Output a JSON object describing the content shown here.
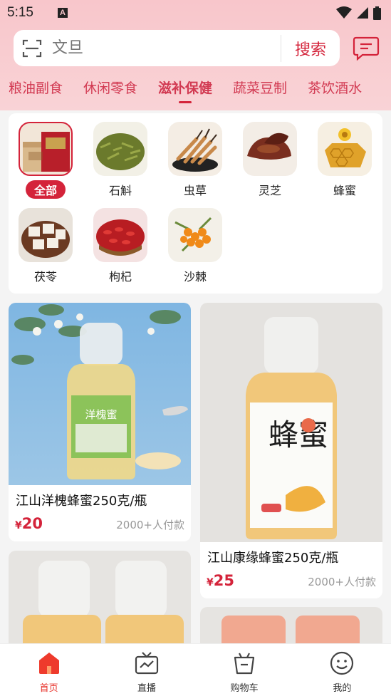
{
  "status": {
    "time": "5:15",
    "notif": "A"
  },
  "search": {
    "placeholder": "文旦",
    "button": "搜索"
  },
  "tabs": [
    {
      "label": "粮油副食",
      "active": false
    },
    {
      "label": "休闲零食",
      "active": false
    },
    {
      "label": "滋补保健",
      "active": true
    },
    {
      "label": "蔬菜豆制",
      "active": false
    },
    {
      "label": "茶饮酒水",
      "active": false
    }
  ],
  "subcategories": [
    {
      "label": "全部",
      "active": true
    },
    {
      "label": "石斛"
    },
    {
      "label": "虫草"
    },
    {
      "label": "灵芝"
    },
    {
      "label": "蜂蜜"
    },
    {
      "label": "茯苓"
    },
    {
      "label": "枸杞"
    },
    {
      "label": "沙棘"
    }
  ],
  "products": [
    {
      "title": "江山洋槐蜂蜜250克/瓶",
      "currency": "¥",
      "price": "20",
      "sold": "2000+人付款",
      "bottle_label": "洋槐蜜"
    },
    {
      "title": "江山康缘蜂蜜250克/瓶",
      "currency": "¥",
      "price": "25",
      "sold": "2000+人付款",
      "bottle_label": "蜂蜜"
    }
  ],
  "nav": [
    {
      "label": "首页",
      "icon": "home-icon",
      "active": true
    },
    {
      "label": "直播",
      "icon": "tv-icon"
    },
    {
      "label": "购物车",
      "icon": "cart-icon"
    },
    {
      "label": "我的",
      "icon": "smile-icon"
    }
  ],
  "colors": {
    "accent": "#d4233a",
    "tab_text": "#d23a52",
    "header_bg": "#f8c6cb"
  }
}
